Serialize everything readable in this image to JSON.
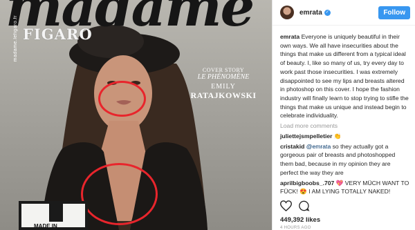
{
  "cover": {
    "masthead": "madame",
    "masthead_sub": "FIGARO",
    "masthead_small": "madame.lefigaro.fr",
    "story_kicker": "COVER STORY",
    "story_title": "LE PHÉNOMÈNE",
    "story_name_first": "EMILY",
    "story_name_last": "RATAJKOWSKI",
    "badge_text": "MADE IN",
    "highlight_color": "#e8252c"
  },
  "post": {
    "username": "emrata",
    "follow_label": "Follow",
    "caption_user": "emrata",
    "caption": "Everyone is uniquely beautiful in their own ways. We all have insecurities about the things that make us different from a typical ideal of beauty. I, like so many of us, try every day to work past those insecurities. I was extremely disappointed to see my lips and breasts altered in photoshop on this cover. I hope the fashion industry will finally learn to stop trying to stifle the things that make us unique and instead begin to celebrate individuality.",
    "load_more": "Load more comments",
    "comments": [
      {
        "user": "juliettejsmpelletier",
        "text": "",
        "emoji": "👏"
      },
      {
        "user": "cristakid",
        "mention": "@emrata",
        "text": " so they actually got a gorgeous pair of breasts and photoshopped them bad, because in my opinion they are perfect the way they are"
      },
      {
        "user": "aprilbigboobs_.707",
        "emoji": "💖",
        "text": " VERY MÜCH WANT TO FÜCK! ",
        "emoji2": "😍",
        "text2": " I AM LYING TOTALLY NAKED!"
      }
    ],
    "likes": "449,392 likes",
    "time": "4 HOURS AGO",
    "accent_color": "#3897f0"
  },
  "icons": [
    "verified-icon",
    "heart-icon",
    "comment-icon"
  ]
}
